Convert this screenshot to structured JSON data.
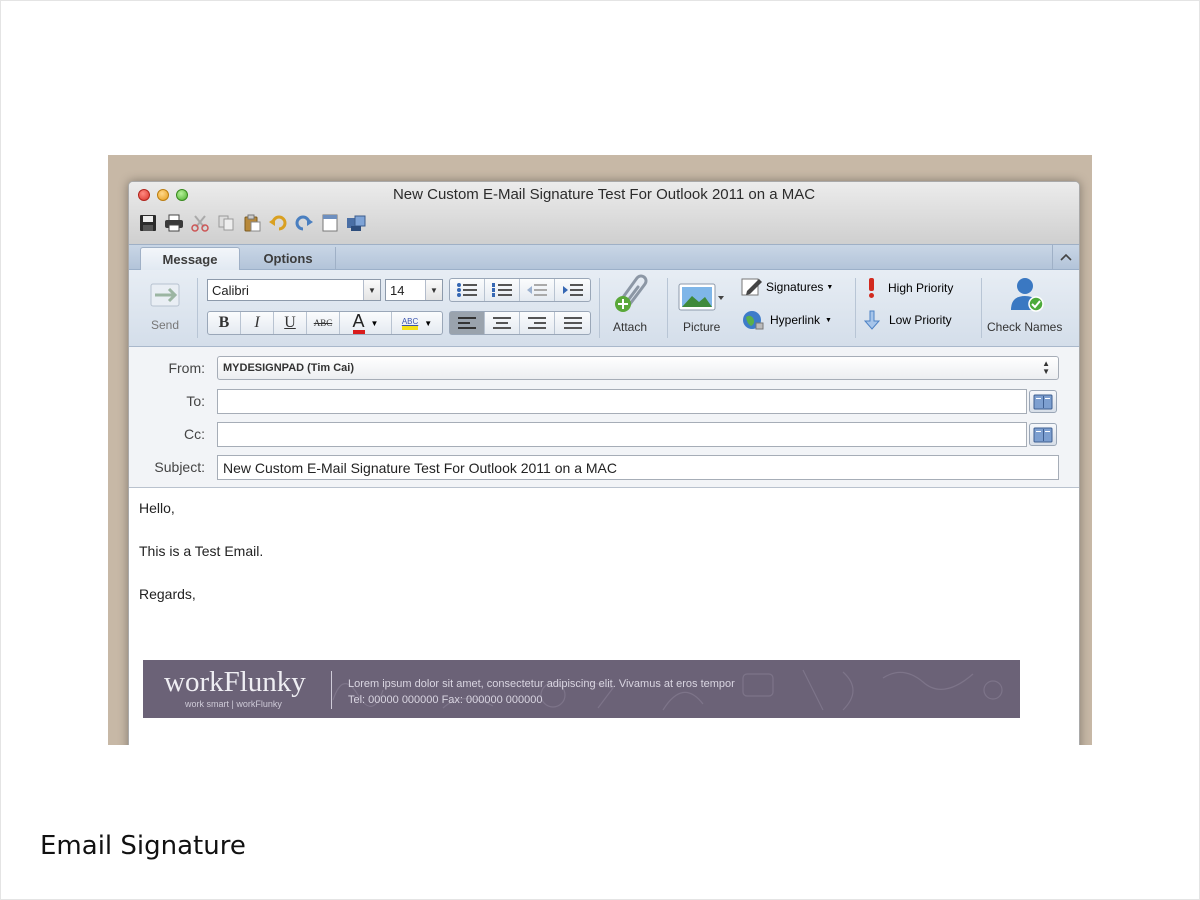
{
  "window": {
    "title": "New Custom E-Mail Signature Test For Outlook 2011 on a MAC"
  },
  "tabs": [
    {
      "label": "Message"
    },
    {
      "label": "Options"
    }
  ],
  "ribbon": {
    "send_label": "Send",
    "font_name": "Calibri",
    "font_size": "14",
    "bold": "B",
    "italic": "I",
    "underline": "U",
    "strike": "ABC",
    "font_color": "A",
    "highlight": "ABC",
    "attach_label": "Attach",
    "picture_label": "Picture",
    "signatures_label": "Signatures",
    "hyperlink_label": "Hyperlink",
    "high_priority_label": "High Priority",
    "low_priority_label": "Low Priority",
    "check_names_label": "Check Names"
  },
  "header": {
    "from_label": "From:",
    "from_value": "MYDESIGNPAD (Tim Cai)",
    "to_label": "To:",
    "to_value": "",
    "cc_label": "Cc:",
    "cc_value": "",
    "subject_label": "Subject:",
    "subject_value": "New Custom E-Mail Signature Test For Outlook 2011 on a MAC"
  },
  "body": {
    "greeting": "Hello,",
    "line1": "This is a Test Email.",
    "closing": "Regards,"
  },
  "signature": {
    "logo": "workFlunky",
    "tagline": "work smart | workFlunky",
    "line1": "Lorem ipsum dolor sit amet, consectetur adipiscing elit. Vivamus at eros tempor",
    "line2": "Tel: 00000 000000   Fax: 000000 000000"
  },
  "caption": "Email Signature",
  "colors": {
    "signature_bg": "#6b6277",
    "tab_bar": "#b3c4d9",
    "ribbon": "#dde5ef"
  }
}
